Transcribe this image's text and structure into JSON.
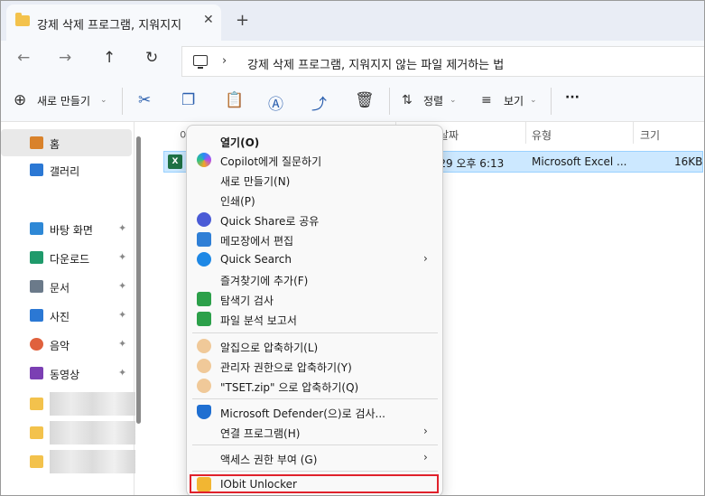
{
  "tab": {
    "title": "강제 삭제 프로그램, 지워지지",
    "close": "✕",
    "new": "+"
  },
  "nav": {
    "back": "←",
    "forward": "→",
    "up": "↑",
    "refresh": "↻"
  },
  "address": {
    "chevron": "›",
    "path": "강제 삭제 프로그램, 지워지지 않는 파일 제거하는 법"
  },
  "toolbar": {
    "new_label": "새로 만들기",
    "sort_label": "정렬",
    "view_label": "보기",
    "more": "···"
  },
  "sidebar": {
    "items": [
      {
        "label": "홈",
        "color": "#d9822b"
      },
      {
        "label": "갤러리",
        "color": "#2b78d4"
      },
      {
        "label": "바탕 화면",
        "color": "#2e88d6"
      },
      {
        "label": "다운로드",
        "color": "#1f9a6b"
      },
      {
        "label": "문서",
        "color": "#6b7a8a"
      },
      {
        "label": "사진",
        "color": "#2b78d4"
      },
      {
        "label": "음악",
        "color": "#e0613d"
      },
      {
        "label": "동영상",
        "color": "#7b3fb3"
      }
    ],
    "pin": "📌"
  },
  "columns": {
    "date": "날짜",
    "type": "유형",
    "size": "크기",
    "name_partial": "이"
  },
  "file": {
    "date": "-29 오후 6:13",
    "type": "Microsoft Excel ...",
    "size": "16KB",
    "icon": "X"
  },
  "menu": {
    "items": [
      {
        "label": "열기(O)",
        "bold": true
      },
      {
        "label": "Copilot에게 질문하기"
      },
      {
        "label": "새로 만들기(N)"
      },
      {
        "label": "인쇄(P)"
      },
      {
        "label": "Quick Share로 공유"
      },
      {
        "label": "메모장에서 편집"
      },
      {
        "label": "Quick Search",
        "sub": true
      },
      {
        "label": "즐겨찾기에 추가(F)"
      },
      {
        "label": "탐색기 검사"
      },
      {
        "label": "파일 분석 보고서"
      },
      {
        "label": "알집으로 압축하기(L)"
      },
      {
        "label": "관리자 권한으로 압축하기(Y)"
      },
      {
        "label": "\"TSET.zip\" 으로 압축하기(Q)"
      },
      {
        "label": "Microsoft Defender(으)로 검사..."
      },
      {
        "label": "연결 프로그램(H)",
        "sub": true
      },
      {
        "label": "액세스 권한 부여 (G)",
        "sub": true
      },
      {
        "label": "IObit Unlocker"
      }
    ],
    "arrow": "›"
  },
  "accent_colors": {
    "highlight_box": "#e0212b",
    "selection": "#cce8ff"
  }
}
